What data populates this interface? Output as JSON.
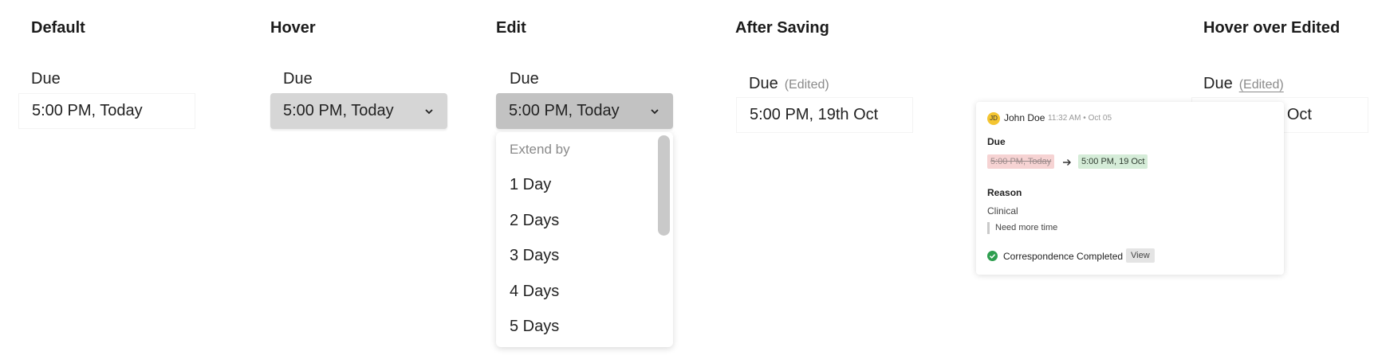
{
  "states": {
    "default": "Default",
    "hover": "Hover",
    "edit": "Edit",
    "after_saving": "After Saving",
    "hover_edited": "Hover over Edited"
  },
  "field": {
    "label": "Due",
    "value_today": "5:00 PM, Today",
    "value_saved": "5:00 PM, 19th Oct",
    "value_saved_partial": "th Oct",
    "edited_tag": "(Edited)"
  },
  "dropdown": {
    "header": "Extend by",
    "options": [
      "1 Day",
      "2 Days",
      "3 Days",
      "4 Days",
      "5 Days"
    ]
  },
  "popover": {
    "avatar_initials": "JD",
    "user": "John Doe",
    "time": "11:32 AM • Oct 05",
    "due_title": "Due",
    "old_value": "5:00 PM, Today",
    "new_value": "5:00 PM, 19 Oct",
    "reason_title": "Reason",
    "reason": "Clinical",
    "note": "Need more time",
    "status": "Correspondence Completed",
    "view_label": "View"
  },
  "colors": {
    "hover_bg": "#d6d6d6",
    "edit_bg": "#c2c2c2",
    "old_chip": "#f6d3d3",
    "new_chip": "#d5ecd8",
    "check": "#2e9e4f",
    "avatar": "#f4c531"
  }
}
